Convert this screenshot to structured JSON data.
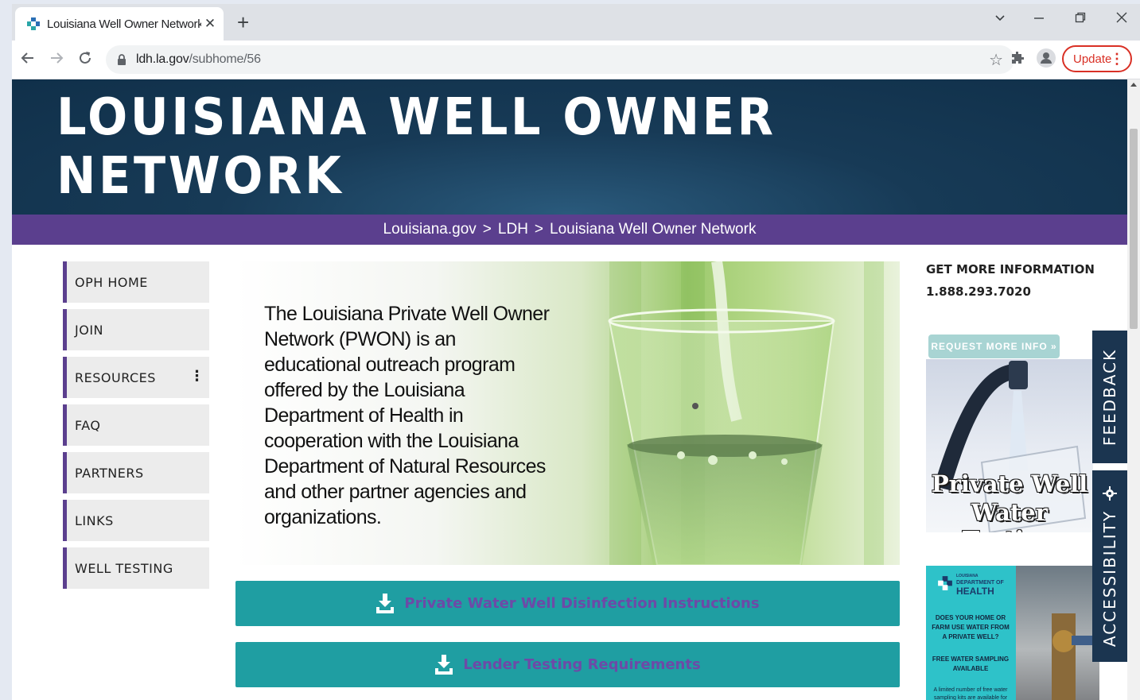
{
  "browser": {
    "tab_title": "Louisiana Well Owner Network |",
    "url_domain": "ldh.la.gov",
    "url_path": "/subhome/56",
    "update_label": "Update"
  },
  "page": {
    "hero_title": "LOUISIANA WELL OWNER NETWORK",
    "breadcrumb": [
      "Louisiana.gov",
      ">",
      "LDH",
      ">",
      "Louisiana Well Owner Network"
    ],
    "nav": [
      "OPH HOME",
      "JOIN",
      "RESOURCES",
      "FAQ",
      "PARTNERS",
      "LINKS",
      "WELL TESTING"
    ],
    "feature_text": "The Louisiana Private Well Owner Network (PWON) is an educational outreach program offered by the Louisiana Department of Health in cooperation with the Louisiana Department of Natural Resources and other partner agencies and organizations.",
    "downloads": [
      "Private Water Well Disinfection Instructions",
      "Lender Testing Requirements"
    ],
    "info_heading": "GET MORE INFORMATION",
    "info_phone": "1.888.293.7020",
    "request_btn": "REQUEST MORE INFO »",
    "promo_line1": "Private Well",
    "promo_line2": "Water Testing",
    "promo2": {
      "logo_line1": "LOUISIANA",
      "logo_line2": "DEPARTMENT OF",
      "logo_line3": "HEALTH",
      "question": "DOES YOUR HOME OR FARM USE WATER FROM A PRIVATE WELL?",
      "free": "FREE WATER SAMPLING AVAILABLE",
      "small": "A limited number of free water sampling kits are available for"
    },
    "feedback_label": "FEEDBACK",
    "accessibility_label": "ACCESSIBILITY"
  },
  "colors": {
    "hero_bg": "#173a56",
    "purple": "#5b3f8e",
    "teal": "#1f9ea2",
    "sidetab": "#1b3550"
  }
}
